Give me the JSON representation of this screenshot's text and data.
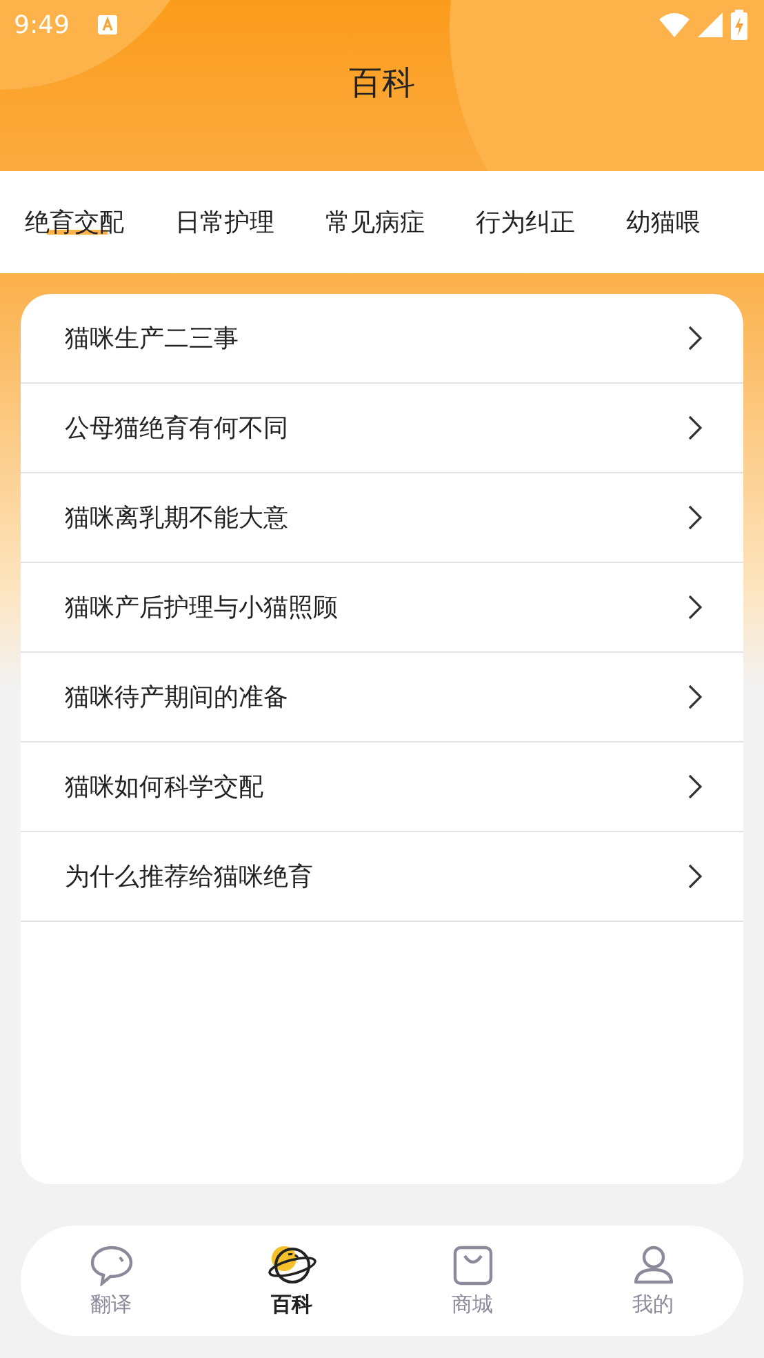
{
  "status_bar": {
    "time": "9:49"
  },
  "header": {
    "title": "百科"
  },
  "tabs": [
    {
      "label": "绝育交配",
      "selected": true
    },
    {
      "label": "日常护理",
      "selected": false
    },
    {
      "label": "常见病症",
      "selected": false
    },
    {
      "label": "行为纠正",
      "selected": false
    },
    {
      "label": "幼猫喂",
      "selected": false
    }
  ],
  "articles": [
    "猫咪生产二三事",
    "公母猫绝育有何不同",
    "猫咪离乳期不能大意",
    "猫咪产后护理与小猫照顾",
    "猫咪待产期间的准备",
    "猫咪如何科学交配",
    "为什么推荐给猫咪绝育"
  ],
  "bottom_nav": [
    {
      "label": "翻译",
      "kind": "chat",
      "selected": false
    },
    {
      "label": "百科",
      "kind": "planet",
      "selected": true
    },
    {
      "label": "商城",
      "kind": "bag",
      "selected": false
    },
    {
      "label": "我的",
      "kind": "person",
      "selected": false
    }
  ]
}
